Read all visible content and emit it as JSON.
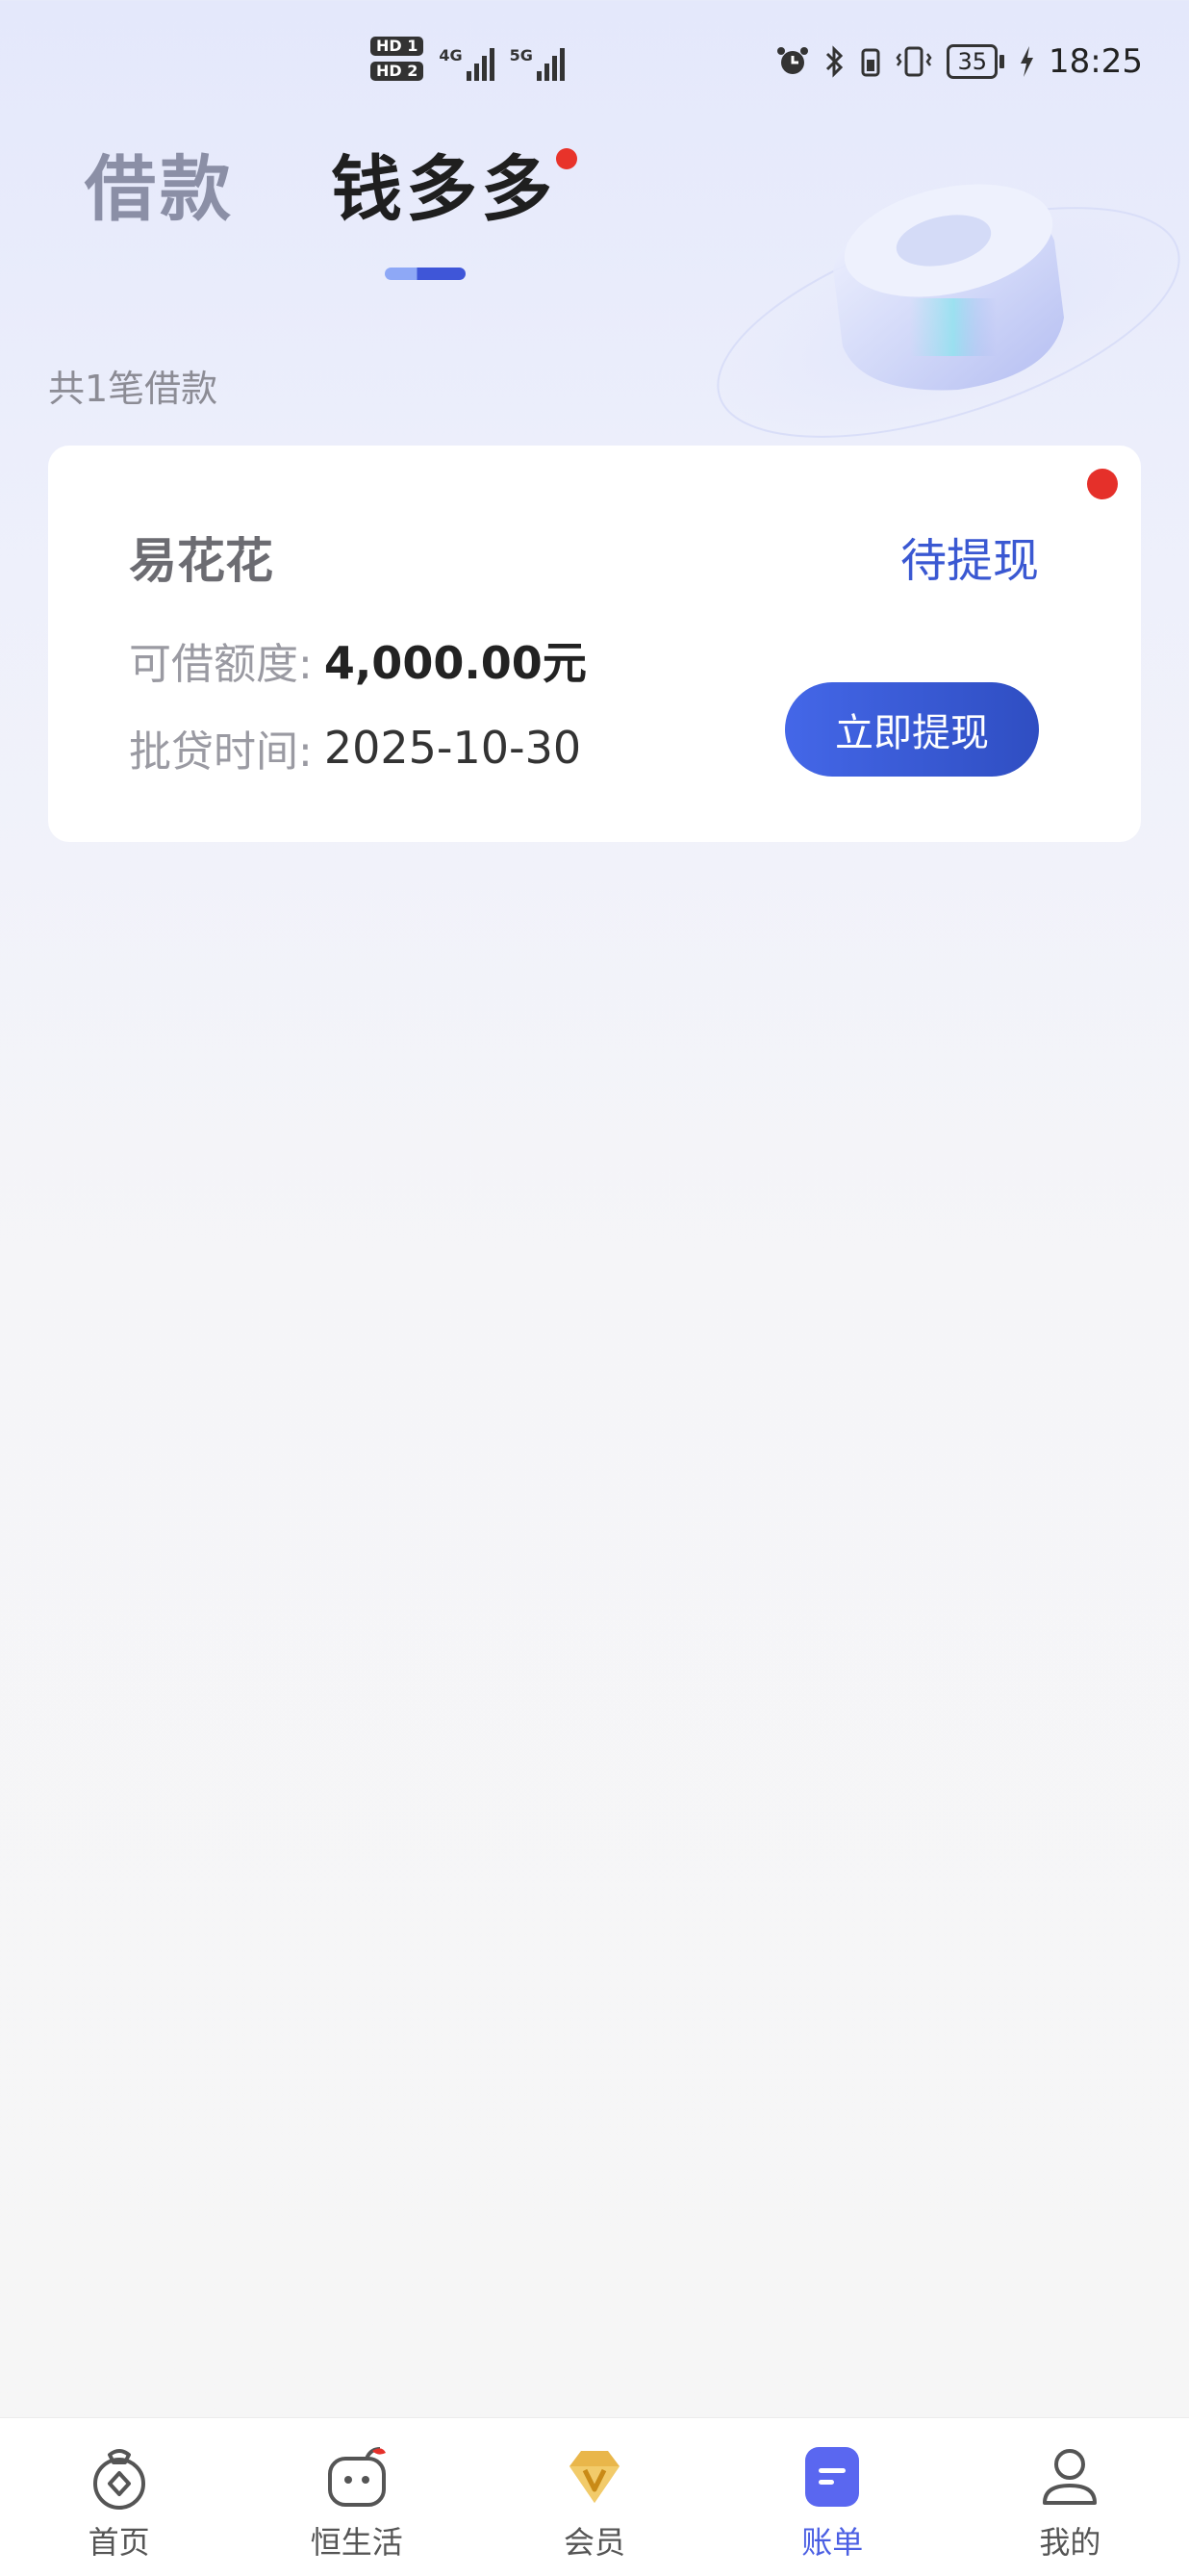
{
  "status_bar": {
    "hd1": "HD 1",
    "hd2": "HD 2",
    "sig1_label": "4G",
    "sig2_label": "5G",
    "battery": "35",
    "time": "18:25"
  },
  "tabs": [
    {
      "label": "借款",
      "active": false
    },
    {
      "label": "钱多多",
      "active": true,
      "has_badge": true
    }
  ],
  "loan_count_text": "共1笔借款",
  "card": {
    "product_name": "易花花",
    "status": "待提现",
    "credit_label": "可借额度:",
    "credit_value": "4,000.00元",
    "approve_label": "批贷时间:",
    "approve_value": "2025-10-30",
    "button_label": "立即提现",
    "has_badge": true
  },
  "bottom_nav": [
    {
      "label": "首页",
      "icon": "home-money-bag-icon",
      "active": false
    },
    {
      "label": "恒生活",
      "icon": "life-face-icon",
      "active": false
    },
    {
      "label": "会员",
      "icon": "diamond-vip-icon",
      "active": false
    },
    {
      "label": "账单",
      "icon": "bill-icon",
      "active": true
    },
    {
      "label": "我的",
      "icon": "person-icon",
      "active": false
    }
  ],
  "colors": {
    "accent": "#3a58d2",
    "badge": "#e5302a",
    "nav_active": "#4b5fe3"
  }
}
